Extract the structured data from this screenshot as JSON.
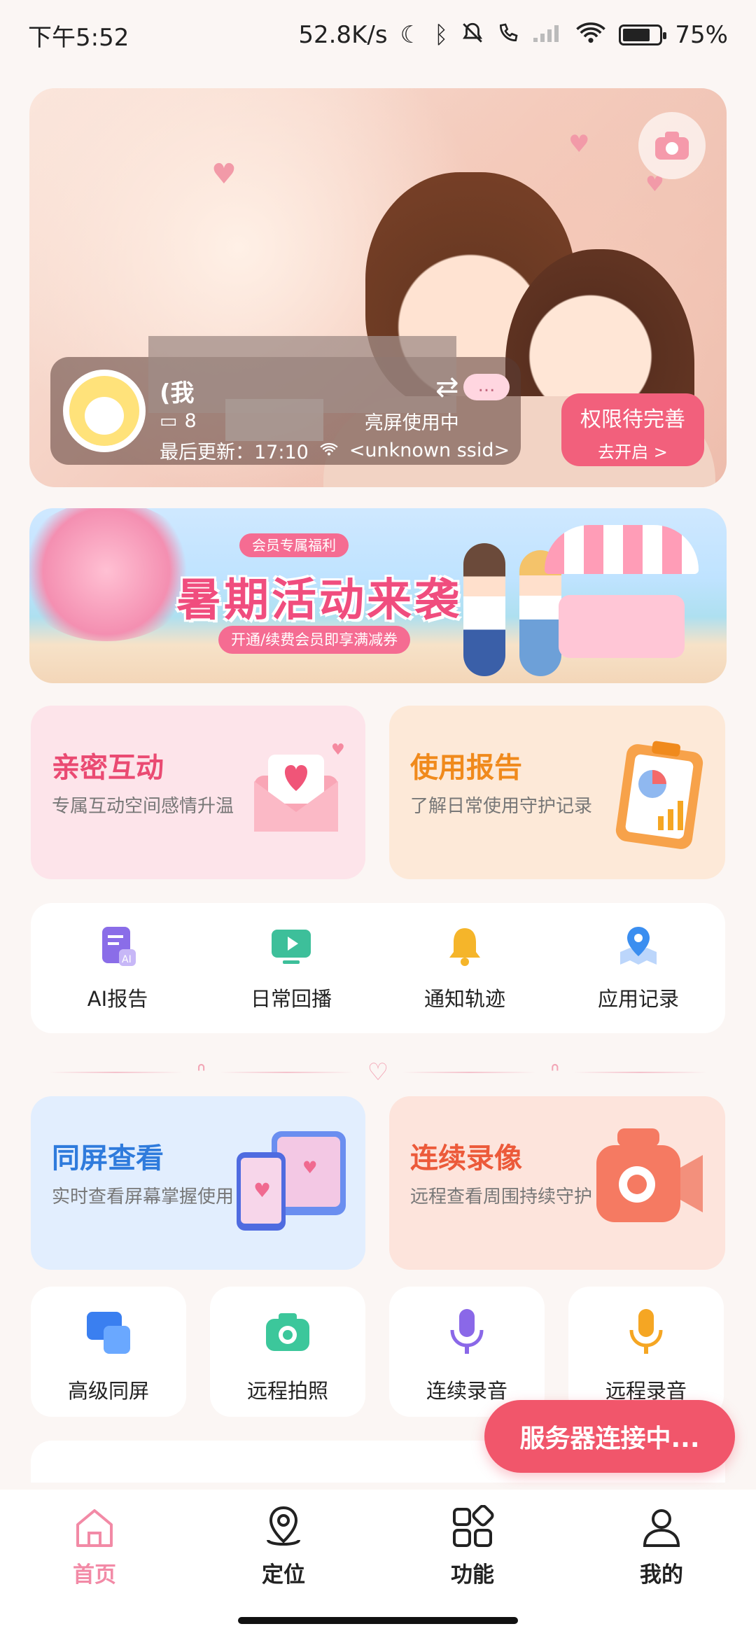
{
  "status_bar": {
    "time": "下午5:52",
    "speed": "52.8K/s",
    "battery": "75%",
    "battery_level": 0.75
  },
  "hero": {
    "device_name": "(我",
    "device_status_prefix": "8",
    "device_status_suffix": "亮屏使用中",
    "last_update": "最后更新：17:10",
    "wifi_ssid": "<unknown ssid>",
    "dots": "...",
    "permission_title": "权限待完善",
    "permission_sub": "去开启 >"
  },
  "banner": {
    "badge": "会员专属福利",
    "title": "暑期活动来袭",
    "subtitle": "开通/续费会员即享满减券"
  },
  "cards": {
    "intimate": {
      "title": "亲密互动",
      "desc": "专属互动空间感情升温"
    },
    "report": {
      "title": "使用报告",
      "desc": "了解日常使用守护记录"
    },
    "same_screen": {
      "title": "同屏查看",
      "desc": "实时查看屏幕掌握使用"
    },
    "record_video": {
      "title": "连续录像",
      "desc": "远程查看周围持续守护"
    }
  },
  "quick_items": [
    {
      "label": "AI报告",
      "icon": "ai-report-icon",
      "color": "#8a6de8"
    },
    {
      "label": "日常回播",
      "icon": "replay-icon",
      "color": "#3dbf9a"
    },
    {
      "label": "通知轨迹",
      "icon": "bell-icon",
      "color": "#f5b52a"
    },
    {
      "label": "应用记录",
      "icon": "map-pin-icon",
      "color": "#3b8ef0"
    }
  ],
  "small_items": [
    {
      "label": "高级同屏",
      "icon": "screens-icon",
      "color": "#3a7ff0"
    },
    {
      "label": "远程拍照",
      "icon": "camera-icon",
      "color": "#3cc79b"
    },
    {
      "label": "连续录音",
      "icon": "mic-icon",
      "color": "#8a68e8"
    },
    {
      "label": "远程录音",
      "icon": "mic-icon",
      "color": "#f5a623"
    }
  ],
  "server_toast": "服务器连接中...",
  "nav": [
    {
      "label": "首页",
      "icon": "home-icon"
    },
    {
      "label": "定位",
      "icon": "location-icon"
    },
    {
      "label": "功能",
      "icon": "apps-icon"
    },
    {
      "label": "我的",
      "icon": "profile-icon"
    }
  ],
  "colors": {
    "accent": "#f1566b",
    "nav_active": "#f28aa6"
  }
}
